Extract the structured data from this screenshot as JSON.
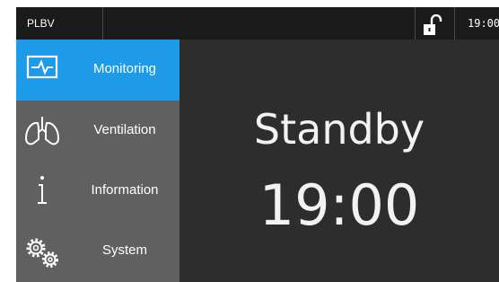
{
  "header": {
    "device_name": "PLBV",
    "clock": "19:00",
    "lock_icon": "unlocked-padlock-icon"
  },
  "sidebar": {
    "items": [
      {
        "label": "Monitoring",
        "icon": "heartbeat-monitor-icon",
        "active": true
      },
      {
        "label": "Ventilation",
        "icon": "lungs-icon",
        "active": false
      },
      {
        "label": "Information",
        "icon": "info-icon",
        "active": false
      },
      {
        "label": "System",
        "icon": "gears-icon",
        "active": false
      }
    ]
  },
  "main": {
    "status": "Standby",
    "time": "19:00"
  },
  "colors": {
    "accent": "#1e9be8",
    "sidebar_bg": "#606060",
    "main_bg": "#2d2d2d",
    "topbar_bg": "#1b1b1b",
    "text": "#f2f2f2"
  }
}
